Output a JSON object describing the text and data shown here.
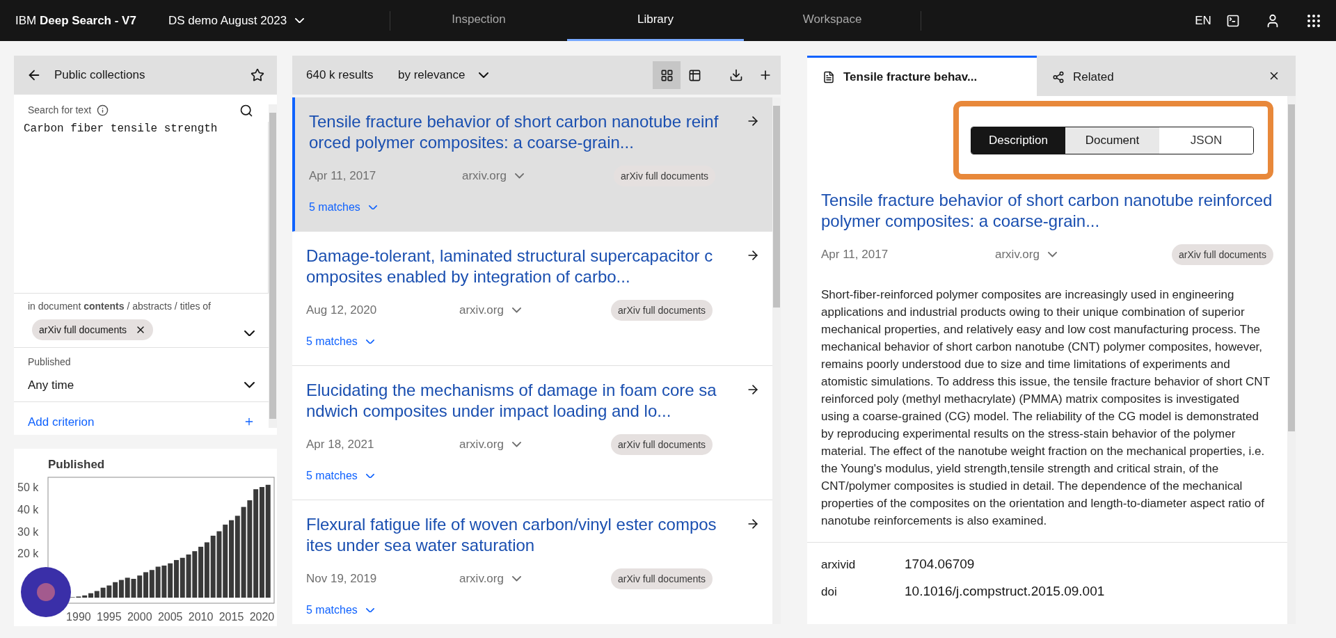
{
  "header": {
    "brand_prefix": "IBM",
    "brand_name": "Deep Search - V7",
    "project": "DS demo August 2023",
    "nav": [
      {
        "label": "Inspection",
        "selected": false
      },
      {
        "label": "Library",
        "selected": true
      },
      {
        "label": "Workspace",
        "selected": false
      }
    ],
    "language": "EN"
  },
  "filters": {
    "title": "Public collections",
    "search_label": "Search for text",
    "query": "Carbon fiber tensile strength",
    "scope_text": "in document **contents** / abstracts / titles of",
    "collection_tag": "arXiv full documents",
    "published_label": "Published",
    "published_value": "Any time",
    "add_criterion": "Add criterion"
  },
  "published_chart": {
    "chart_data": {
      "type": "bar",
      "title": "Published",
      "x": [
        1989,
        1990,
        1991,
        1992,
        1993,
        1994,
        1995,
        1996,
        1997,
        1998,
        1999,
        2000,
        2001,
        2002,
        2003,
        2004,
        2005,
        2006,
        2007,
        2008,
        2009,
        2010,
        2011,
        2012,
        2013,
        2014,
        2015,
        2016,
        2017,
        2018,
        2019,
        2020,
        2021
      ],
      "values": [
        0.2,
        0.5,
        1,
        2,
        3,
        4.5,
        5.5,
        7,
        8,
        9,
        8.5,
        10,
        11.5,
        12.5,
        14,
        14.5,
        15.5,
        17,
        18,
        19.5,
        21,
        23,
        25,
        28,
        30,
        33,
        35,
        37,
        41,
        44,
        49,
        50,
        51
      ],
      "ylim": [
        0,
        54.4
      ],
      "xlim": [
        1985,
        2022
      ],
      "yticks": [
        {
          "value": 20,
          "label": "20 k"
        },
        {
          "value": 30,
          "label": "30 k"
        },
        {
          "value": 40,
          "label": "40 k"
        },
        {
          "value": 50,
          "label": "50 k"
        }
      ],
      "xticks": [
        1990,
        1995,
        2000,
        2005,
        2010,
        2015,
        2020
      ]
    }
  },
  "results": {
    "count": "640 k results",
    "sort": "by relevance",
    "views": [
      {
        "kind": "grid",
        "selected": true
      },
      {
        "kind": "table",
        "selected": false
      }
    ],
    "items": [
      {
        "title": "Tensile fracture behavior of short carbon nanotube reinforced polymer composites: a coarse-grain...",
        "date": "Apr 11, 2017",
        "source": "arxiv.org",
        "tag": "arXiv full documents",
        "matches": "5 matches",
        "selected": true
      },
      {
        "title": "Damage-tolerant, laminated structural supercapacitor composites enabled by integration of carbo...",
        "date": "Aug 12, 2020",
        "source": "arxiv.org",
        "tag": "arXiv full documents",
        "matches": "5 matches",
        "selected": false
      },
      {
        "title": "Elucidating the mechanisms of damage in foam core sandwich composites under impact loading and lo...",
        "date": "Apr 18, 2021",
        "source": "arxiv.org",
        "tag": "arXiv full documents",
        "matches": "5 matches",
        "selected": false
      },
      {
        "title": "Flexural fatigue life of woven carbon/vinyl ester composites under sea water saturation",
        "date": "Nov 19, 2019",
        "source": "arxiv.org",
        "tag": "arXiv full documents",
        "matches": "5 matches",
        "selected": false
      }
    ]
  },
  "detail": {
    "tabs": [
      {
        "label": "Tensile fracture behav...",
        "kind": "document",
        "selected": true
      },
      {
        "label": "Related",
        "kind": "related",
        "selected": false
      }
    ],
    "view_switch": {
      "highlighted": true,
      "options": [
        {
          "label": "Description",
          "selected": true,
          "hovered": false
        },
        {
          "label": "Document",
          "selected": false,
          "hovered": true
        },
        {
          "label": "JSON",
          "selected": false,
          "hovered": false
        }
      ]
    },
    "title": "Tensile fracture behavior of short carbon nanotube reinforced polymer composites: a coarse-grain...",
    "date": "Apr 11, 2017",
    "source": "arxiv.org",
    "tag": "arXiv full documents",
    "abstract": "Short-fiber-reinforced polymer composites are increasingly used in engineering applications and industrial products owing to their unique combination of superior mechanical properties, and relatively easy and low cost manufacturing process. The mechanical behavior of short carbon nanotube (CNT) polymer composites, however, remains poorly understood due to size and time limitations of experiments and atomistic simulations. To address this issue, the tensile fracture behavior of short CNT reinforced poly (methyl methacrylate) (PMMA) matrix composites is investigated using a coarse-grained (CG) model. The reliability of the CG model is demonstrated by reproducing experimental results on the stress-stain behavior of the polymer material. The effect of the nanotube weight fraction on the mechanical properties, i.e. the Young's modulus, yield strength,tensile strength and critical strain, of the CNT/polymer composites is studied in detail. The dependence of the mechanical properties of the composites on the orientation and length-to-diameter aspect ratio of nanotube reinforcements is also examined.",
    "fields": [
      {
        "key": "arxivid",
        "value": "1704.06709"
      },
      {
        "key": "doi",
        "value": "10.1016/j.compstruct.2015.09.001"
      }
    ]
  }
}
